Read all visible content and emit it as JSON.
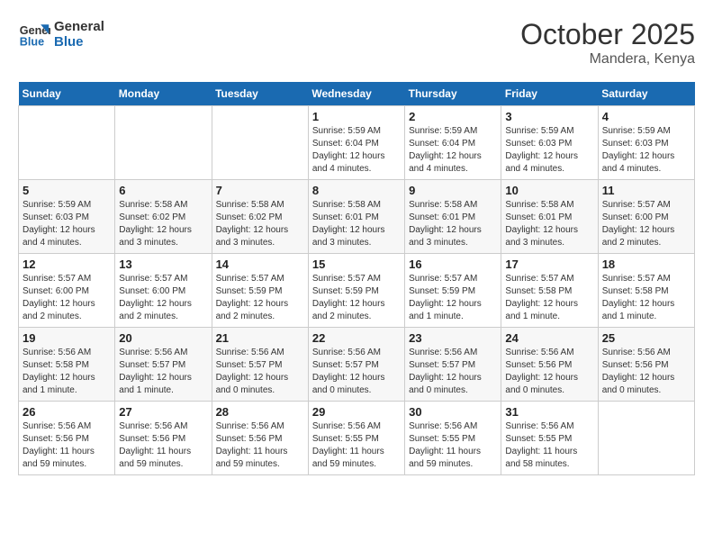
{
  "header": {
    "logo_line1": "General",
    "logo_line2": "Blue",
    "month": "October 2025",
    "location": "Mandera, Kenya"
  },
  "weekdays": [
    "Sunday",
    "Monday",
    "Tuesday",
    "Wednesday",
    "Thursday",
    "Friday",
    "Saturday"
  ],
  "weeks": [
    [
      {
        "day": "",
        "info": ""
      },
      {
        "day": "",
        "info": ""
      },
      {
        "day": "",
        "info": ""
      },
      {
        "day": "1",
        "info": "Sunrise: 5:59 AM\nSunset: 6:04 PM\nDaylight: 12 hours and 4 minutes."
      },
      {
        "day": "2",
        "info": "Sunrise: 5:59 AM\nSunset: 6:04 PM\nDaylight: 12 hours and 4 minutes."
      },
      {
        "day": "3",
        "info": "Sunrise: 5:59 AM\nSunset: 6:03 PM\nDaylight: 12 hours and 4 minutes."
      },
      {
        "day": "4",
        "info": "Sunrise: 5:59 AM\nSunset: 6:03 PM\nDaylight: 12 hours and 4 minutes."
      }
    ],
    [
      {
        "day": "5",
        "info": "Sunrise: 5:59 AM\nSunset: 6:03 PM\nDaylight: 12 hours and 4 minutes."
      },
      {
        "day": "6",
        "info": "Sunrise: 5:58 AM\nSunset: 6:02 PM\nDaylight: 12 hours and 3 minutes."
      },
      {
        "day": "7",
        "info": "Sunrise: 5:58 AM\nSunset: 6:02 PM\nDaylight: 12 hours and 3 minutes."
      },
      {
        "day": "8",
        "info": "Sunrise: 5:58 AM\nSunset: 6:01 PM\nDaylight: 12 hours and 3 minutes."
      },
      {
        "day": "9",
        "info": "Sunrise: 5:58 AM\nSunset: 6:01 PM\nDaylight: 12 hours and 3 minutes."
      },
      {
        "day": "10",
        "info": "Sunrise: 5:58 AM\nSunset: 6:01 PM\nDaylight: 12 hours and 3 minutes."
      },
      {
        "day": "11",
        "info": "Sunrise: 5:57 AM\nSunset: 6:00 PM\nDaylight: 12 hours and 2 minutes."
      }
    ],
    [
      {
        "day": "12",
        "info": "Sunrise: 5:57 AM\nSunset: 6:00 PM\nDaylight: 12 hours and 2 minutes."
      },
      {
        "day": "13",
        "info": "Sunrise: 5:57 AM\nSunset: 6:00 PM\nDaylight: 12 hours and 2 minutes."
      },
      {
        "day": "14",
        "info": "Sunrise: 5:57 AM\nSunset: 5:59 PM\nDaylight: 12 hours and 2 minutes."
      },
      {
        "day": "15",
        "info": "Sunrise: 5:57 AM\nSunset: 5:59 PM\nDaylight: 12 hours and 2 minutes."
      },
      {
        "day": "16",
        "info": "Sunrise: 5:57 AM\nSunset: 5:59 PM\nDaylight: 12 hours and 1 minute."
      },
      {
        "day": "17",
        "info": "Sunrise: 5:57 AM\nSunset: 5:58 PM\nDaylight: 12 hours and 1 minute."
      },
      {
        "day": "18",
        "info": "Sunrise: 5:57 AM\nSunset: 5:58 PM\nDaylight: 12 hours and 1 minute."
      }
    ],
    [
      {
        "day": "19",
        "info": "Sunrise: 5:56 AM\nSunset: 5:58 PM\nDaylight: 12 hours and 1 minute."
      },
      {
        "day": "20",
        "info": "Sunrise: 5:56 AM\nSunset: 5:57 PM\nDaylight: 12 hours and 1 minute."
      },
      {
        "day": "21",
        "info": "Sunrise: 5:56 AM\nSunset: 5:57 PM\nDaylight: 12 hours and 0 minutes."
      },
      {
        "day": "22",
        "info": "Sunrise: 5:56 AM\nSunset: 5:57 PM\nDaylight: 12 hours and 0 minutes."
      },
      {
        "day": "23",
        "info": "Sunrise: 5:56 AM\nSunset: 5:57 PM\nDaylight: 12 hours and 0 minutes."
      },
      {
        "day": "24",
        "info": "Sunrise: 5:56 AM\nSunset: 5:56 PM\nDaylight: 12 hours and 0 minutes."
      },
      {
        "day": "25",
        "info": "Sunrise: 5:56 AM\nSunset: 5:56 PM\nDaylight: 12 hours and 0 minutes."
      }
    ],
    [
      {
        "day": "26",
        "info": "Sunrise: 5:56 AM\nSunset: 5:56 PM\nDaylight: 11 hours and 59 minutes."
      },
      {
        "day": "27",
        "info": "Sunrise: 5:56 AM\nSunset: 5:56 PM\nDaylight: 11 hours and 59 minutes."
      },
      {
        "day": "28",
        "info": "Sunrise: 5:56 AM\nSunset: 5:56 PM\nDaylight: 11 hours and 59 minutes."
      },
      {
        "day": "29",
        "info": "Sunrise: 5:56 AM\nSunset: 5:55 PM\nDaylight: 11 hours and 59 minutes."
      },
      {
        "day": "30",
        "info": "Sunrise: 5:56 AM\nSunset: 5:55 PM\nDaylight: 11 hours and 59 minutes."
      },
      {
        "day": "31",
        "info": "Sunrise: 5:56 AM\nSunset: 5:55 PM\nDaylight: 11 hours and 58 minutes."
      },
      {
        "day": "",
        "info": ""
      }
    ]
  ]
}
